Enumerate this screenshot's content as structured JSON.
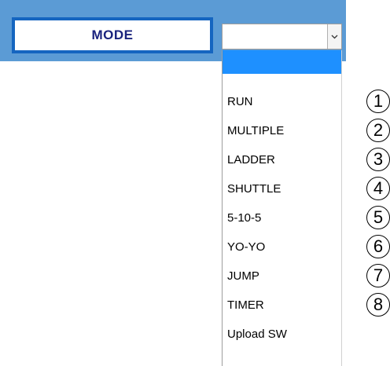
{
  "mode": {
    "label": "MODE"
  },
  "select": {
    "value": "",
    "arrow_icon": "chevron-down-icon"
  },
  "dropdown": {
    "items": [
      {
        "label": "",
        "selected": true
      },
      {
        "label": "RUN"
      },
      {
        "label": "MULTIPLE"
      },
      {
        "label": "LADDER"
      },
      {
        "label": "SHUTTLE"
      },
      {
        "label": "5-10-5"
      },
      {
        "label": "YO-YO"
      },
      {
        "label": "JUMP"
      },
      {
        "label": "TIMER"
      },
      {
        "label": "Upload SW"
      }
    ]
  },
  "markers": [
    "1",
    "2",
    "3",
    "4",
    "5",
    "6",
    "7",
    "8"
  ],
  "colors": {
    "toolbar_bg": "#5b9bd5",
    "mode_border": "#1565c0",
    "mode_text": "#1a237e",
    "selected_bg": "#1e90ff"
  }
}
